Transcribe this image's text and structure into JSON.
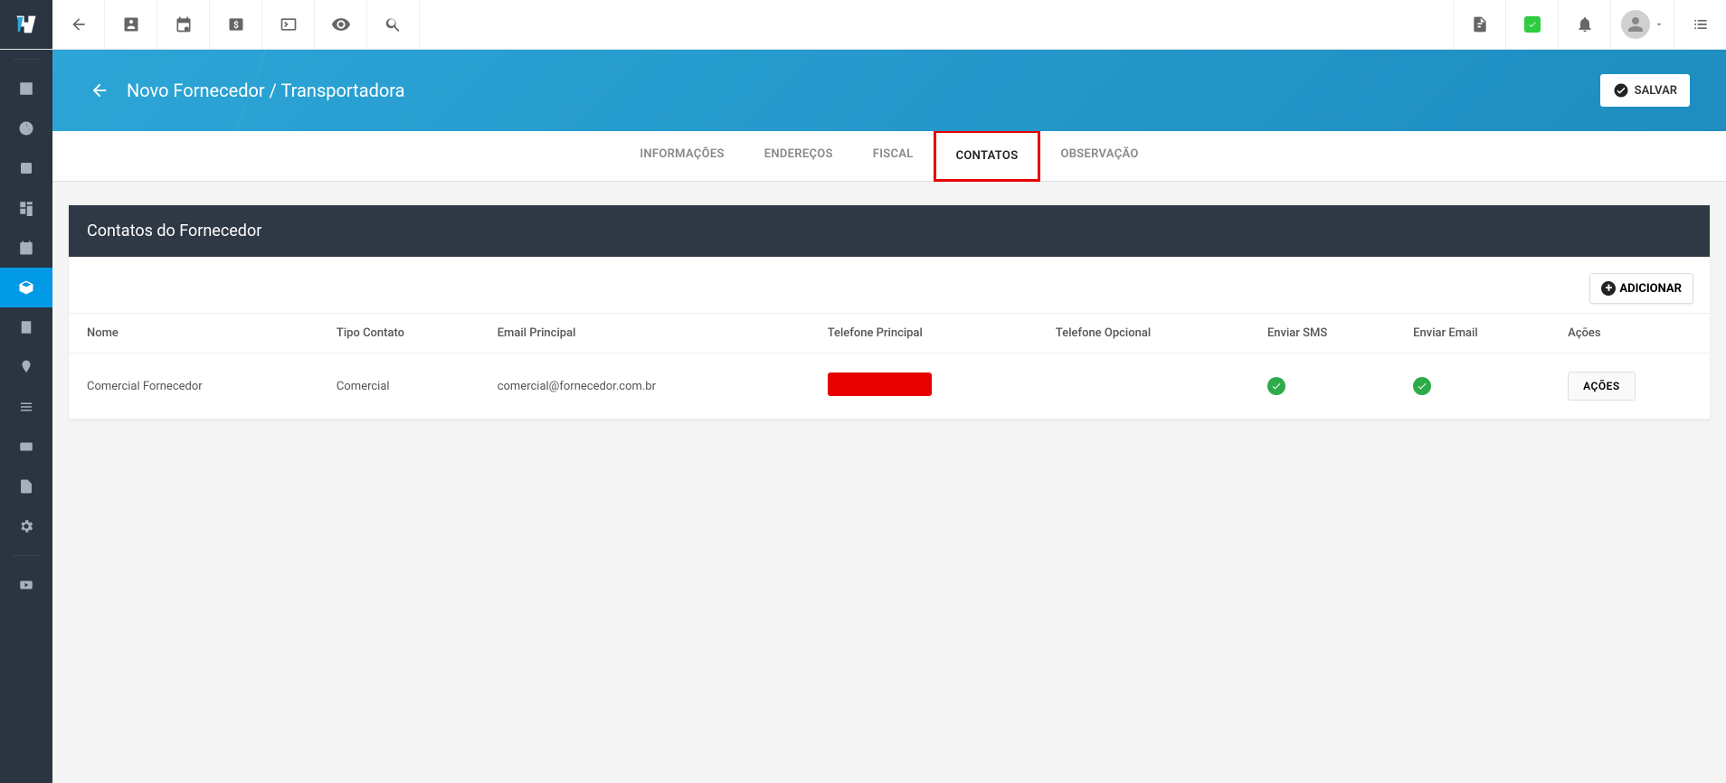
{
  "header": {
    "title": "Novo Fornecedor / Transportadora",
    "save_label": "SALVAR"
  },
  "tabs": [
    {
      "label": "INFORMAÇÕES",
      "active": false
    },
    {
      "label": "ENDEREÇOS",
      "active": false
    },
    {
      "label": "FISCAL",
      "active": false
    },
    {
      "label": "CONTATOS",
      "active": true
    },
    {
      "label": "OBSERVAÇÃO",
      "active": false
    }
  ],
  "panel": {
    "title": "Contatos do Fornecedor",
    "add_label": "ADICIONAR"
  },
  "table": {
    "columns": [
      "Nome",
      "Tipo Contato",
      "Email Principal",
      "Telefone Principal",
      "Telefone Opcional",
      "Enviar SMS",
      "Enviar Email",
      "Ações"
    ],
    "rows": [
      {
        "nome": "Comercial Fornecedor",
        "tipo": "Comercial",
        "email": "comercial@fornecedor.com.br",
        "telefone_principal_redacted": true,
        "telefone_opcional": "",
        "enviar_sms": true,
        "enviar_email": true,
        "acoes_label": "AÇÕES"
      }
    ]
  },
  "topbar_icons": [
    "back",
    "contact",
    "calendar",
    "money",
    "terminal",
    "eye",
    "search"
  ],
  "topbar_right_icons": [
    "pdf",
    "chat-check",
    "bell",
    "avatar",
    "menu-list"
  ],
  "sidebar_icons": [
    "dashboard",
    "chart",
    "person",
    "board",
    "calendar2",
    "package",
    "receipt",
    "pin",
    "list",
    "card",
    "doc",
    "settings",
    "video"
  ]
}
